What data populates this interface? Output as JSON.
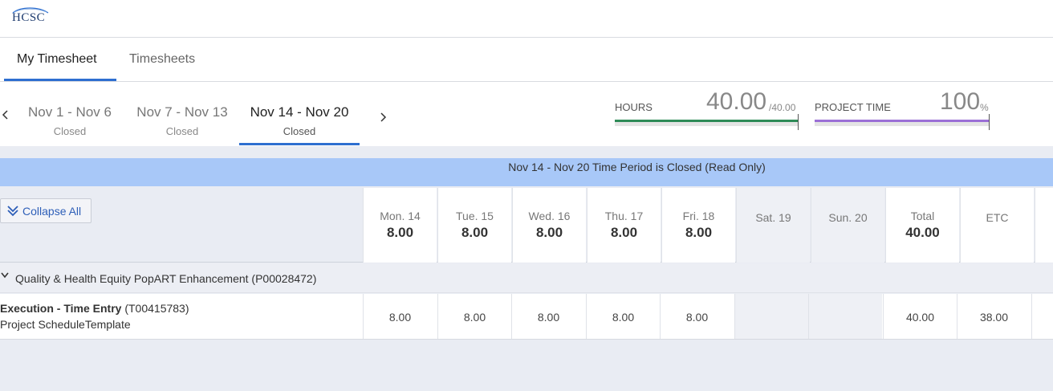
{
  "app": {
    "logo_text": "HCSC"
  },
  "tabs": [
    {
      "label": "My Timesheet",
      "active": true
    },
    {
      "label": "Timesheets",
      "active": false
    }
  ],
  "periods": [
    {
      "range": "Nov 1 - Nov 6",
      "status": "Closed"
    },
    {
      "range": "Nov 7 - Nov 13",
      "status": "Closed"
    },
    {
      "range": "Nov 14 - Nov 20",
      "status": "Closed",
      "active": true
    }
  ],
  "meters": {
    "hours": {
      "label": "HOURS",
      "value": "40.00",
      "unit": "/40.00",
      "fraction": 1.0,
      "color": "#2e8b57"
    },
    "project_time": {
      "label": "PROJECT TIME",
      "value": "100",
      "unit": "%",
      "fraction": 1.0,
      "color": "#9b6fd6"
    }
  },
  "banner": {
    "text": "Nov 14 - Nov 20 Time Period is Closed (Read Only)"
  },
  "toolbar": {
    "collapse_label": "Collapse All"
  },
  "columns": [
    {
      "name": "Mon. 14",
      "hours": "8.00"
    },
    {
      "name": "Tue. 15",
      "hours": "8.00"
    },
    {
      "name": "Wed. 16",
      "hours": "8.00"
    },
    {
      "name": "Thu. 17",
      "hours": "8.00"
    },
    {
      "name": "Fri. 18",
      "hours": "8.00"
    },
    {
      "name": "Sat. 19",
      "hours": ""
    },
    {
      "name": "Sun. 20",
      "hours": ""
    },
    {
      "name": "Total",
      "hours": "40.00"
    },
    {
      "name": "ETC",
      "hours": ""
    }
  ],
  "project": {
    "title": "Quality & Health Equity PopART Enhancement (P00028472)"
  },
  "task": {
    "name_bold": "Execution - Time Entry",
    "name_id": " (T00415783)",
    "subtitle": "Project ScheduleTemplate",
    "cells": [
      "8.00",
      "8.00",
      "8.00",
      "8.00",
      "8.00",
      "",
      "",
      "40.00",
      "38.00"
    ]
  },
  "colors": {
    "accent": "#2e6fd0",
    "banner": "#a8c8f8"
  }
}
